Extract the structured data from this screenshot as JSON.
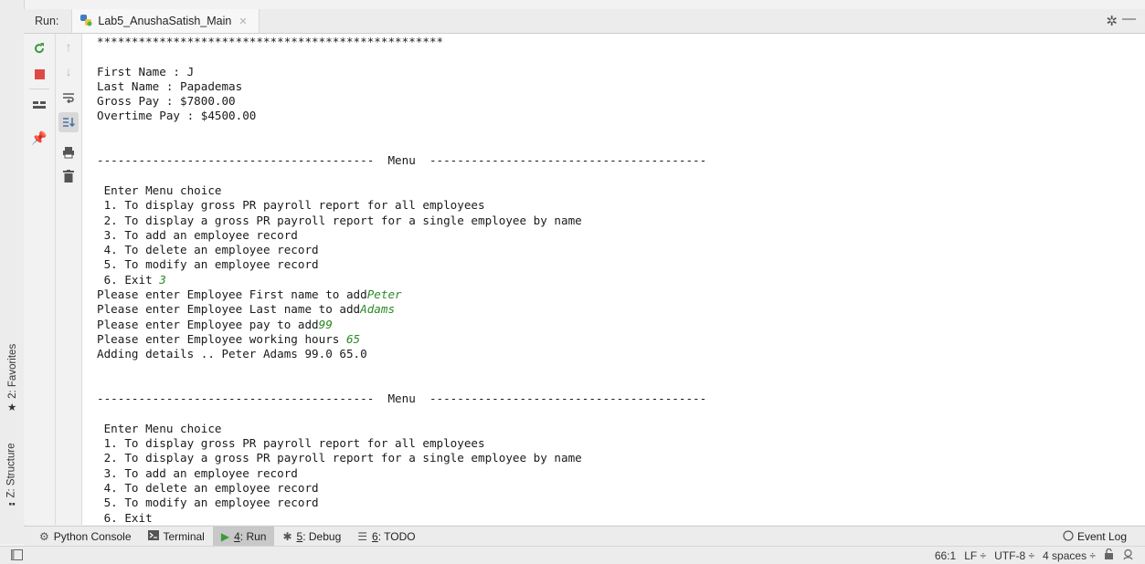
{
  "run_header": {
    "label": "Run:",
    "tab_title": "Lab5_AnushaSatish_Main"
  },
  "left_tabs": {
    "favorites": "2: Favorites",
    "structure": "Z: Structure"
  },
  "icons": {
    "rerun": "rerun-icon",
    "stop": "stop-icon",
    "layout": "layout-icon",
    "pin": "pin-icon",
    "up": "arrow-up-icon",
    "down": "arrow-down-icon",
    "wrap": "soft-wrap-icon",
    "scroll": "scroll-to-end-icon",
    "print": "print-icon",
    "trash": "trash-icon",
    "settings": "gear-icon",
    "hide": "minimize-icon"
  },
  "console": {
    "lines": [
      [
        {
          "t": "**************************************************"
        }
      ],
      [
        {
          "t": ""
        }
      ],
      [
        {
          "t": "First Name : J"
        }
      ],
      [
        {
          "t": "Last Name : Papademas"
        }
      ],
      [
        {
          "t": "Gross Pay : $7800.00"
        }
      ],
      [
        {
          "t": "Overtime Pay : $4500.00"
        }
      ],
      [
        {
          "t": ""
        }
      ],
      [
        {
          "t": ""
        }
      ],
      [
        {
          "t": "----------------------------------------  Menu  ----------------------------------------"
        }
      ],
      [
        {
          "t": ""
        }
      ],
      [
        {
          "t": " Enter Menu choice"
        }
      ],
      [
        {
          "t": " 1. To display gross PR payroll report for all employees"
        }
      ],
      [
        {
          "t": " 2. To display a gross PR payroll report for a single employee by name"
        }
      ],
      [
        {
          "t": " 3. To add an employee record"
        }
      ],
      [
        {
          "t": " 4. To delete an employee record"
        }
      ],
      [
        {
          "t": " 5. To modify an employee record"
        }
      ],
      [
        {
          "t": " 6. Exit "
        },
        {
          "t": "3",
          "input": true
        }
      ],
      [
        {
          "t": "Please enter Employee First name to add"
        },
        {
          "t": "Peter",
          "input": true
        }
      ],
      [
        {
          "t": "Please enter Employee Last name to add"
        },
        {
          "t": "Adams",
          "input": true
        }
      ],
      [
        {
          "t": "Please enter Employee pay to add"
        },
        {
          "t": "99",
          "input": true
        }
      ],
      [
        {
          "t": "Please enter Employee working hours "
        },
        {
          "t": "65",
          "input": true
        }
      ],
      [
        {
          "t": "Adding details .. Peter Adams 99.0 65.0"
        }
      ],
      [
        {
          "t": ""
        }
      ],
      [
        {
          "t": ""
        }
      ],
      [
        {
          "t": "----------------------------------------  Menu  ----------------------------------------"
        }
      ],
      [
        {
          "t": ""
        }
      ],
      [
        {
          "t": " Enter Menu choice"
        }
      ],
      [
        {
          "t": " 1. To display gross PR payroll report for all employees"
        }
      ],
      [
        {
          "t": " 2. To display a gross PR payroll report for a single employee by name"
        }
      ],
      [
        {
          "t": " 3. To add an employee record"
        }
      ],
      [
        {
          "t": " 4. To delete an employee record"
        }
      ],
      [
        {
          "t": " 5. To modify an employee record"
        }
      ],
      [
        {
          "t": " 6. Exit"
        }
      ]
    ],
    "input_color": "#2b8a24"
  },
  "bottom_tabs": {
    "python_console": "Python Console",
    "terminal": "Terminal",
    "run_num": "4",
    "run_text": ": Run",
    "debug_num": "5",
    "debug_text": ": Debug",
    "todo_num": "6",
    "todo_text": ": TODO",
    "event_log": "Event Log"
  },
  "status": {
    "position": "66:1",
    "line_sep": "LF ÷",
    "encoding": "UTF-8 ÷",
    "indent": "4 spaces ÷"
  }
}
